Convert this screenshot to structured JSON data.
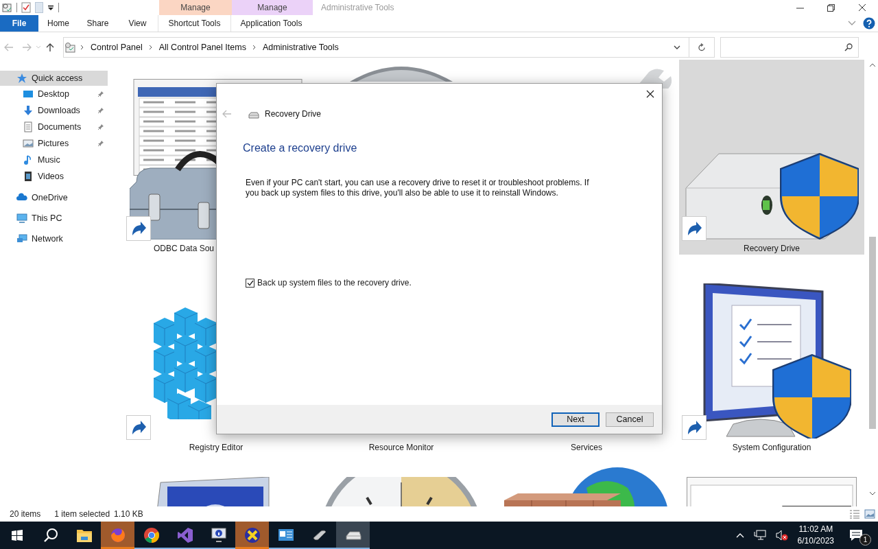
{
  "window": {
    "title": "Administrative Tools"
  },
  "ribbon": {
    "tabs": [
      {
        "label": "File",
        "kind": "file",
        "selected": false
      },
      {
        "label": "Home",
        "kind": "plain",
        "selected": false
      },
      {
        "label": "Share",
        "kind": "plain",
        "selected": false
      },
      {
        "label": "View",
        "kind": "plain",
        "selected": false
      }
    ],
    "context_groups": [
      {
        "header": "Manage",
        "tab": "Shortcut Tools",
        "color": "#fbd6c3",
        "selected": false
      },
      {
        "header": "Manage",
        "tab": "Application Tools",
        "color": "#ebd2f8",
        "selected": false
      }
    ]
  },
  "address_bar": {
    "segments": [
      "Control Panel",
      "All Control Panel Items",
      "Administrative Tools"
    ]
  },
  "sidebar": {
    "items": [
      {
        "label": "Quick access",
        "kind": "star",
        "selected": true,
        "children": [
          {
            "label": "Desktop",
            "kind": "desktop",
            "pinned": true,
            "selected": false
          },
          {
            "label": "Downloads",
            "kind": "download",
            "pinned": true,
            "selected": false
          },
          {
            "label": "Documents",
            "kind": "document",
            "pinned": true,
            "selected": false
          },
          {
            "label": "Pictures",
            "kind": "picture",
            "pinned": true,
            "selected": false
          },
          {
            "label": "Music",
            "kind": "music",
            "pinned": false,
            "selected": false
          },
          {
            "label": "Videos",
            "kind": "video",
            "pinned": false,
            "selected": false
          }
        ]
      },
      {
        "label": "OneDrive",
        "kind": "cloud",
        "selected": false
      },
      {
        "label": "This PC",
        "kind": "pc",
        "selected": false
      },
      {
        "label": "Network",
        "kind": "network",
        "selected": false
      }
    ]
  },
  "files": [
    {
      "label": "ODBC Data Sou",
      "kind": "odbc",
      "shortcut": true,
      "selected": false
    },
    {
      "kind": "disc",
      "shortcut": false,
      "selected": false
    },
    {
      "kind": "tool",
      "shortcut": false,
      "selected": false
    },
    {
      "label": "Recovery Drive",
      "kind": "drive",
      "shortcut": true,
      "selected": true
    },
    {
      "label": "Registry Editor",
      "kind": "cubes",
      "shortcut": true,
      "selected": false
    },
    {
      "label": "Resource Monitor",
      "shortcut": false,
      "selected": false
    },
    {
      "label": "Services",
      "shortcut": false,
      "selected": false
    },
    {
      "label": "System Configuration",
      "kind": "checklist",
      "shortcut": true,
      "selected": false
    },
    {
      "kind": "info",
      "shortcut": false,
      "selected": false
    },
    {
      "kind": "clock",
      "shortcut": false,
      "selected": false
    },
    {
      "kind": "globe",
      "shortcut": false,
      "selected": false
    },
    {
      "kind": "window",
      "shortcut": false,
      "selected": false
    }
  ],
  "status_bar": {
    "item_count": "20 items",
    "selection": "1 item selected",
    "size": "1.10 KB"
  },
  "dialog": {
    "title": "Recovery Drive",
    "heading": "Create a recovery drive",
    "description": "Even if your PC can't start, you can use a recovery drive to reset it or troubleshoot problems. If you back up system files to this drive, you'll also be able to use it to reinstall Windows.",
    "checkbox": {
      "label": "Back up system files to the recovery drive.",
      "checked": true
    },
    "buttons": [
      {
        "label": "Next",
        "default": true
      },
      {
        "label": "Cancel",
        "default": false
      }
    ]
  },
  "taskbar": {
    "apps": [
      {
        "kind": "explorer",
        "running": false,
        "flashing": false,
        "active": false
      },
      {
        "kind": "firefox",
        "running": true,
        "flashing": true,
        "active": false
      },
      {
        "kind": "chrome",
        "running": true,
        "flashing": false,
        "active": false
      },
      {
        "kind": "studio",
        "running": true,
        "flashing": false,
        "active": false
      },
      {
        "kind": "info",
        "running": true,
        "flashing": false,
        "active": false
      },
      {
        "kind": "xapp",
        "running": true,
        "flashing": true,
        "active": false
      },
      {
        "kind": "panel",
        "running": true,
        "flashing": false,
        "active": false
      },
      {
        "kind": "mouse",
        "running": true,
        "flashing": false,
        "active": false
      },
      {
        "kind": "drive",
        "running": true,
        "flashing": false,
        "active": true
      }
    ],
    "time": "11:02 AM",
    "date": "6/10/2023",
    "notification_count": "1"
  }
}
